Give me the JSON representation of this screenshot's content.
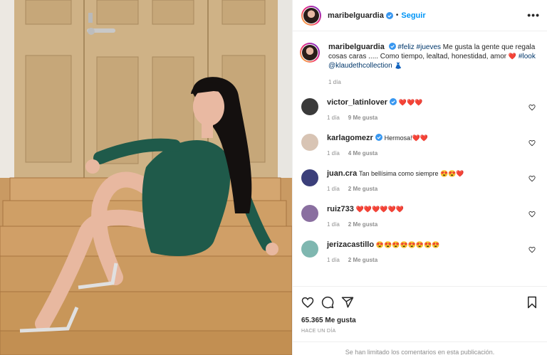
{
  "post": {
    "username": "maribelguardia",
    "follow_label": "Seguir",
    "more_label": "•••",
    "caption": {
      "username": "maribelguardia",
      "tags1": "#feliz #jueves",
      "text": " Me gusta la gente que regala cosas caras ..... Como tiempo, lealtad, honestidad, amor ",
      "heart": "❤️",
      "tag2": "#look",
      "mention": "@klaudethcollection",
      "dress": "👗",
      "time": "1 día"
    },
    "likes_total": "65.365 Me gusta",
    "posted_ago": "HACE UN DÍA",
    "comments_limited": "Se han limitado los comentarios en esta publicación."
  },
  "comments": [
    {
      "user": "victor_latinlover",
      "verified": true,
      "text": "❤️❤️❤️",
      "time": "1 día",
      "likes": "9 Me gusta",
      "avatar_color": "#3a3a3a"
    },
    {
      "user": "karlagomezr",
      "verified": true,
      "text": "Hermosa!❤️❤️",
      "time": "1 día",
      "likes": "4 Me gusta",
      "avatar_color": "#d8c4b4"
    },
    {
      "user": "juan.cra",
      "verified": false,
      "text": "Tan bellísima como siempre 😍😍❤️",
      "time": "1 día",
      "likes": "2 Me gusta",
      "avatar_color": "#3b3f7a"
    },
    {
      "user": "ruiz733",
      "verified": false,
      "text": "❤️❤️❤️❤️❤️❤️",
      "time": "1 día",
      "likes": "2 Me gusta",
      "avatar_color": "#8a6fa0"
    },
    {
      "user": "jerizacastillo",
      "verified": false,
      "text": "😍😍😍😍😍😍😍😍",
      "time": "1 día",
      "likes": "2 Me gusta",
      "avatar_color": "#7fb7b0"
    }
  ],
  "colors": {
    "accent": "#0095f6",
    "link": "#00376b",
    "muted": "#8e8e8e",
    "dress": "#1f5a4a"
  }
}
